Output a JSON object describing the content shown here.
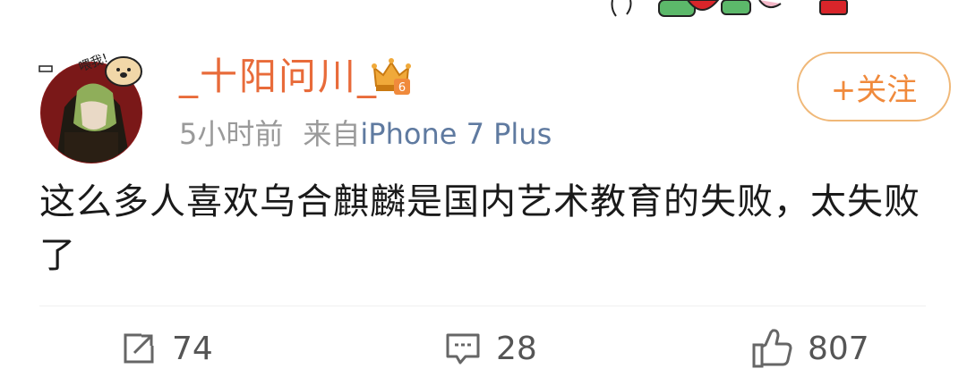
{
  "post": {
    "username": "_十阳问川_",
    "time": "5小时前",
    "source_prefix": "来自",
    "source": "iPhone 7 Plus",
    "follow_label": "+关注",
    "content": "这么多人喜欢乌合麒麟是国内艺术教育的失败，太失败了"
  },
  "avatar": {
    "sticker_text": "喂我!",
    "badge_letter": "6"
  },
  "actions": {
    "repost_count": "74",
    "comment_count": "28",
    "like_count": "807"
  },
  "icons": {
    "repost": "repost-icon",
    "comment": "comment-icon",
    "like": "thumbs-up-icon",
    "vip": "crown-icon"
  },
  "colors": {
    "username": "#e86b3a",
    "follow": "#f08a3c",
    "follow_border": "#f0b878",
    "source_link": "#5f7aa0",
    "meta": "#9a9a9a",
    "text": "#1a1a1a"
  }
}
